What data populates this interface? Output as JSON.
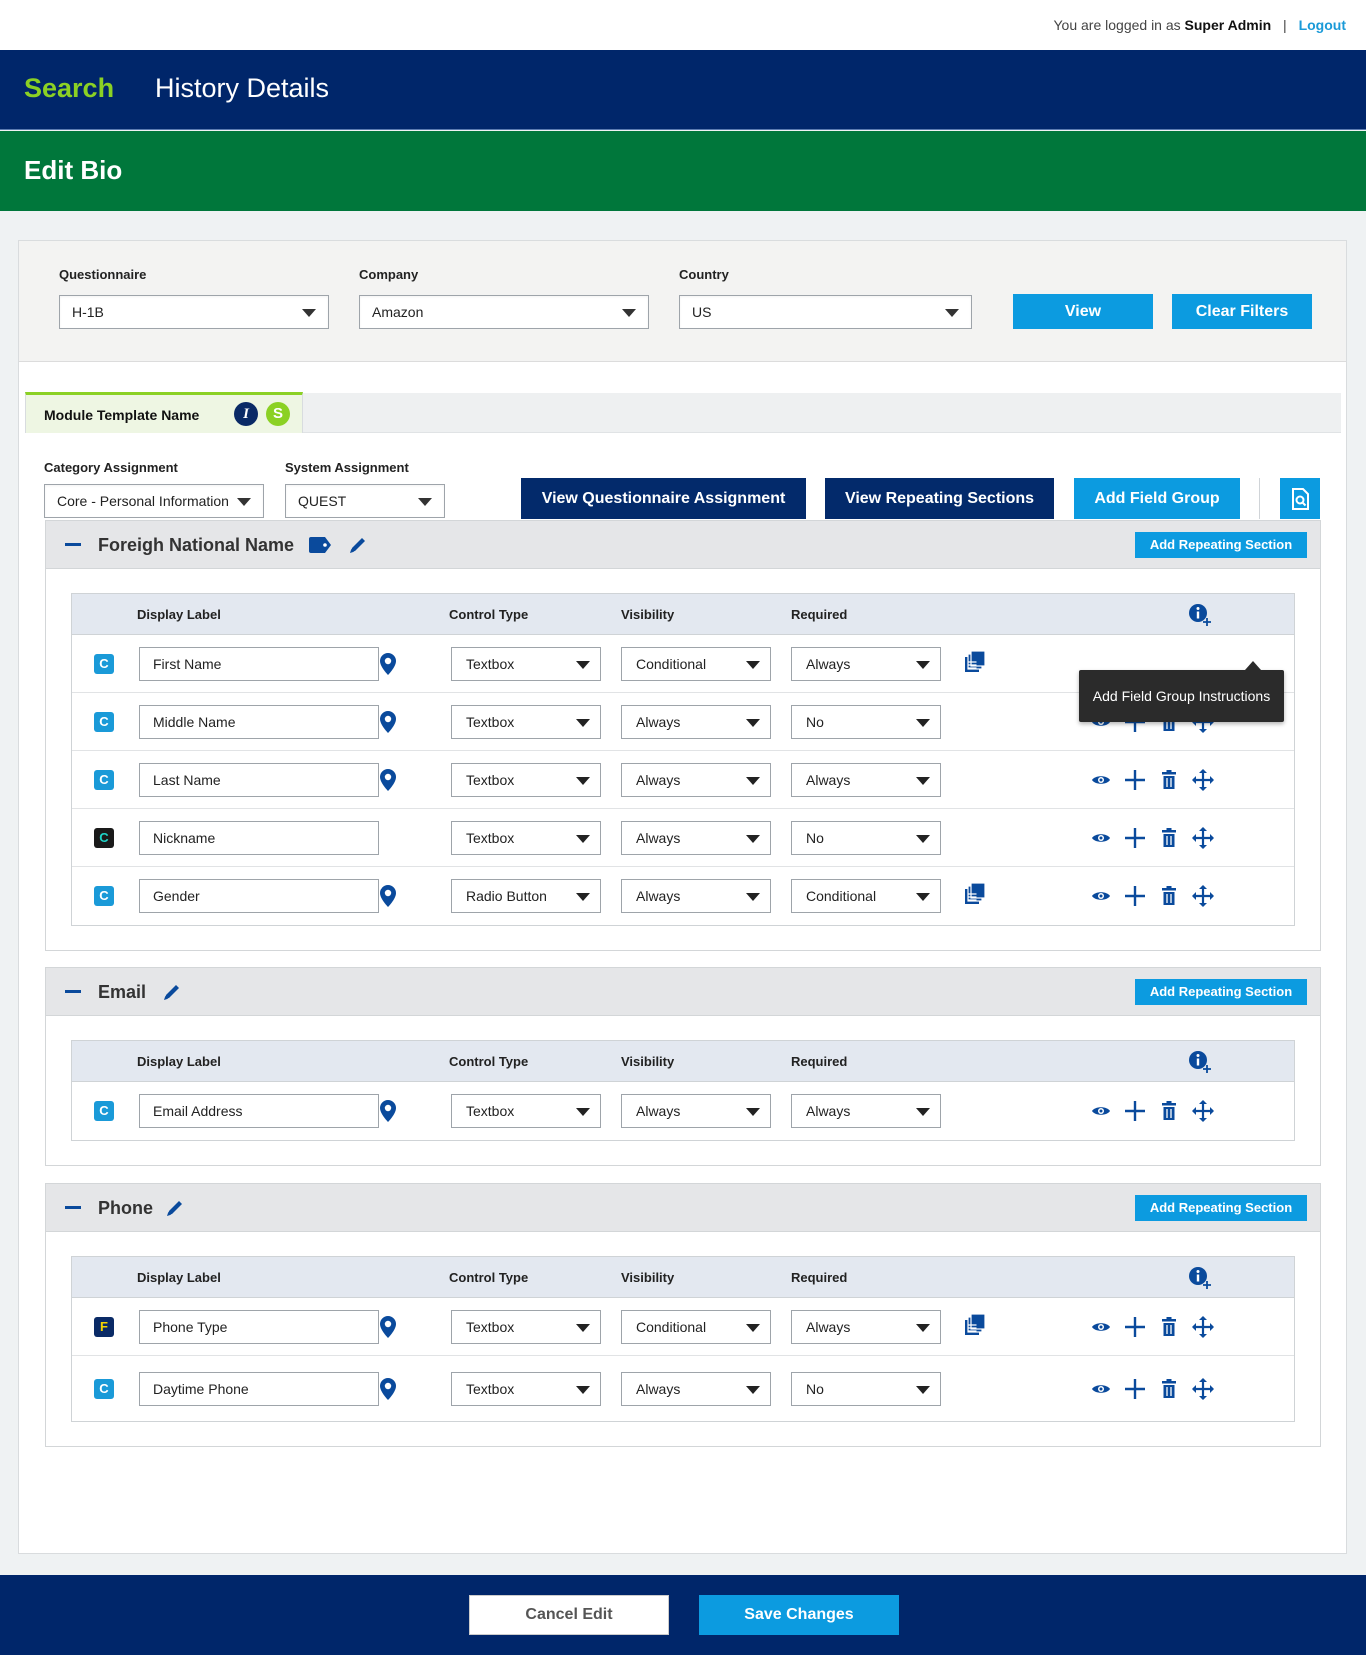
{
  "header": {
    "logged_in_prefix": "You are logged in as",
    "user": "Super Admin",
    "separator": "|",
    "logout": "Logout"
  },
  "nav": {
    "search": "Search",
    "history": "History Details"
  },
  "page_title": "Edit Bio",
  "filters": {
    "questionnaire_label": "Questionnaire",
    "questionnaire_value": "H-1B",
    "company_label": "Company",
    "company_value": "Amazon",
    "country_label": "Country",
    "country_value": "US",
    "view_button": "View",
    "clear_button": "Clear Filters"
  },
  "tab": {
    "name": "Module Template Name",
    "badge_i": "I",
    "badge_s": "S"
  },
  "assignment": {
    "category_label": "Category Assignment",
    "category_value": "Core - Personal Information",
    "system_label": "System Assignment",
    "system_value": "QUEST",
    "view_questionnaire": "View Questionnaire Assignment",
    "view_repeating": "View Repeating Sections",
    "add_field_group": "Add Field Group"
  },
  "columns": {
    "display_label": "Display Label",
    "control_type": "Control Type",
    "visibility": "Visibility",
    "required": "Required"
  },
  "add_repeating_section": "Add Repeating Section",
  "tooltip": "Add Field Group Instructions",
  "groups": [
    {
      "title": "Foreigh National Name",
      "rows": [
        {
          "badge": "C",
          "label": "First Name",
          "control": "Textbox",
          "visibility": "Conditional",
          "required": "Always"
        },
        {
          "badge": "C",
          "label": "Middle Name",
          "control": "Textbox",
          "visibility": "Always",
          "required": "No"
        },
        {
          "badge": "C",
          "label": "Last Name",
          "control": "Textbox",
          "visibility": "Always",
          "required": "Always"
        },
        {
          "badge": "C",
          "label": "Nickname",
          "control": "Textbox",
          "visibility": "Always",
          "required": "No"
        },
        {
          "badge": "C",
          "label": "Gender",
          "control": "Radio Button",
          "visibility": "Always",
          "required": "Conditional"
        }
      ]
    },
    {
      "title": "Email",
      "rows": [
        {
          "badge": "C",
          "label": "Email Address",
          "control": "Textbox",
          "visibility": "Always",
          "required": "Always"
        }
      ]
    },
    {
      "title": "Phone",
      "rows": [
        {
          "badge": "F",
          "label": "Phone Type",
          "control": "Textbox",
          "visibility": "Conditional",
          "required": "Always"
        },
        {
          "badge": "C",
          "label": "Daytime Phone",
          "control": "Textbox",
          "visibility": "Always",
          "required": "No"
        }
      ]
    }
  ],
  "footer": {
    "cancel": "Cancel Edit",
    "save": "Save Changes"
  },
  "colors": {
    "navy": "#00266a",
    "green_title": "#00773b",
    "accent_green": "#8bd124",
    "blue_button": "#0c9be0",
    "icon_blue": "#0a4a9c",
    "badge_black": "#1a1a1a",
    "badge_f_yellow": "#f5d400"
  },
  "icons": [
    "tag-icon",
    "pencil-icon",
    "location-pin-icon",
    "copy-stack-icon",
    "info-plus-icon",
    "eye-icon",
    "plus-icon",
    "trash-icon",
    "move-icon",
    "document-search-icon"
  ]
}
